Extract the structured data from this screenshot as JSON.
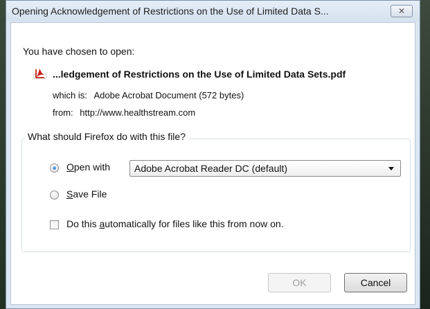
{
  "window": {
    "title": "Opening Acknowledgement of Restrictions on the Use of Limited Data S...",
    "close_glyph": "✕"
  },
  "dialog": {
    "chosen_text": "You have chosen to open:",
    "file_name": "...ledgement of Restrictions on the Use of Limited Data Sets.pdf",
    "file_icon": "pdf-file-icon",
    "which_is_label": "which is:",
    "which_is_value": "Adobe Acrobat Document (572 bytes)",
    "from_label": "from:",
    "from_value": "http://www.healthstream.com"
  },
  "action_group": {
    "legend": "What should Firefox do with this file?",
    "open_with_label": {
      "mnemonic": "O",
      "rest": "pen with"
    },
    "open_with_selected": true,
    "app_select_value": "Adobe Acrobat Reader DC  (default)",
    "save_file_label": {
      "mnemonic": "S",
      "rest": "ave File"
    },
    "save_file_selected": false,
    "auto_label": {
      "before": "Do this ",
      "mnemonic": "a",
      "after": "utomatically for files like this from now on."
    },
    "auto_checked": false
  },
  "buttons": {
    "ok_label": "OK",
    "ok_enabled": false,
    "cancel_label": "Cancel"
  },
  "colors": {
    "pdf_red": "#c8201a",
    "radio_accent": "#1a5fb4"
  }
}
